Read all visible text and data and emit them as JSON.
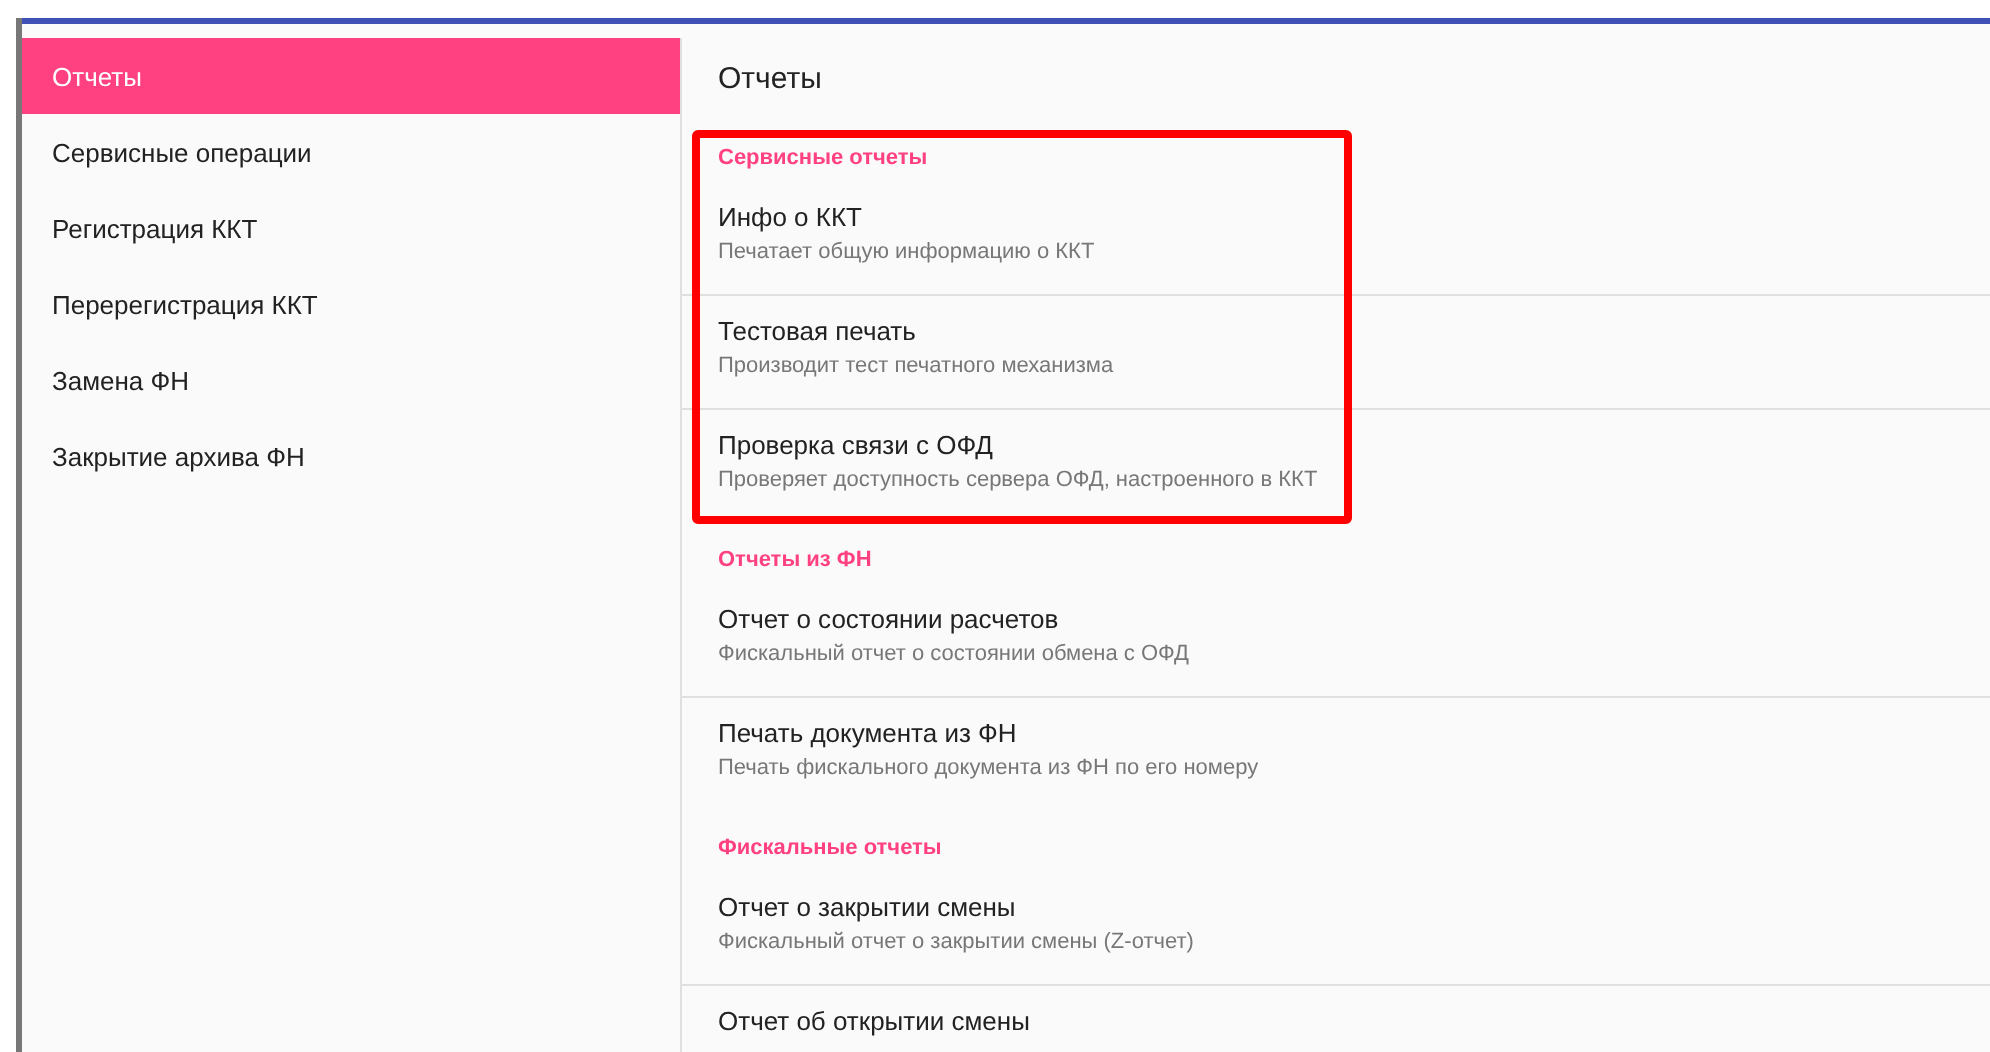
{
  "sidebar": {
    "items": [
      {
        "label": "Отчеты",
        "selected": true
      },
      {
        "label": "Сервисные операции",
        "selected": false
      },
      {
        "label": "Регистрация ККТ",
        "selected": false
      },
      {
        "label": "Перерегистрация ККТ",
        "selected": false
      },
      {
        "label": "Замена ФН",
        "selected": false
      },
      {
        "label": "Закрытие архива ФН",
        "selected": false
      }
    ]
  },
  "content": {
    "title": "Отчеты",
    "sections": [
      {
        "header": "Сервисные отчеты",
        "highlighted": true,
        "items": [
          {
            "title": "Инфо о ККТ",
            "subtitle": "Печатает общую информацию о ККТ"
          },
          {
            "title": "Тестовая печать",
            "subtitle": "Производит тест печатного механизма"
          },
          {
            "title": "Проверка связи с ОФД",
            "subtitle": "Проверяет доступность сервера ОФД, настроенного в ККТ"
          }
        ]
      },
      {
        "header": "Отчеты из ФН",
        "highlighted": false,
        "items": [
          {
            "title": "Отчет о состоянии расчетов",
            "subtitle": "Фискальный отчет о состоянии обмена с ОФД"
          },
          {
            "title": "Печать документа из ФН",
            "subtitle": "Печать фискального документа из ФН по его номеру"
          }
        ]
      },
      {
        "header": "Фискальные отчеты",
        "highlighted": false,
        "items": [
          {
            "title": "Отчет о закрытии смены",
            "subtitle": "Фискальный отчет о закрытии смены (Z-отчет)"
          },
          {
            "title": "Отчет об открытии смены"
          }
        ]
      }
    ]
  }
}
